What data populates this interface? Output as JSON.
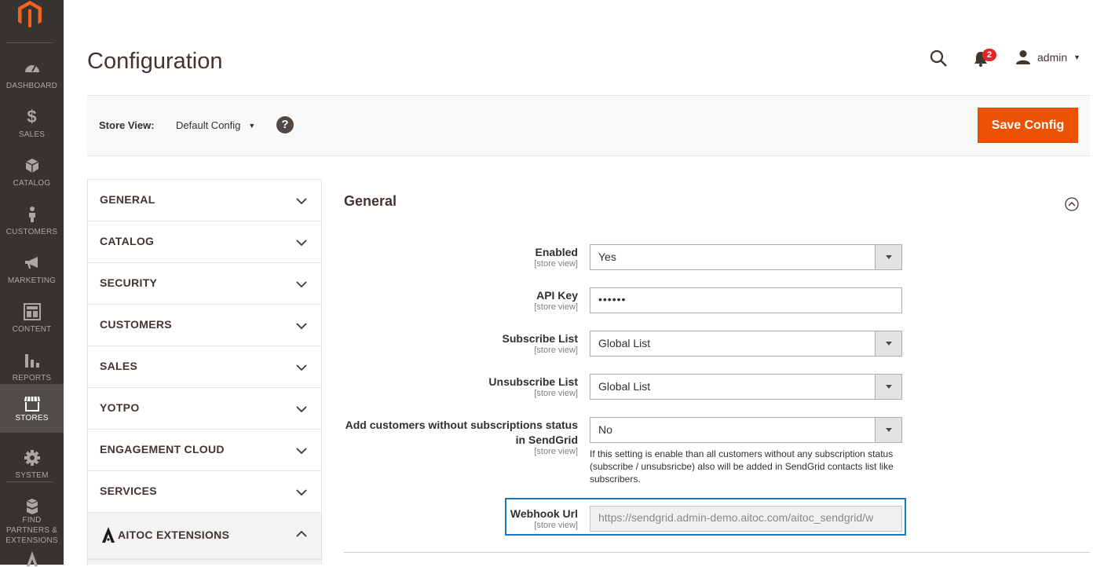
{
  "nav": {
    "items": [
      {
        "label": "DASHBOARD",
        "icon": "dashboard-icon"
      },
      {
        "label": "SALES",
        "icon": "dollar-icon"
      },
      {
        "label": "CATALOG",
        "icon": "cube-icon"
      },
      {
        "label": "CUSTOMERS",
        "icon": "person-icon"
      },
      {
        "label": "MARKETING",
        "icon": "megaphone-icon"
      },
      {
        "label": "CONTENT",
        "icon": "layout-icon"
      },
      {
        "label": "REPORTS",
        "icon": "bar-chart-icon"
      },
      {
        "label": "STORES",
        "icon": "storefront-icon",
        "active": true
      },
      {
        "label": "SYSTEM",
        "icon": "gear-icon"
      },
      {
        "label": "FIND PARTNERS & EXTENSIONS",
        "icon": "boxes-icon"
      }
    ]
  },
  "header": {
    "title": "Configuration",
    "notification_count": "2",
    "user": "admin"
  },
  "scope": {
    "label": "Store View:",
    "value": "Default Config",
    "help": "?",
    "save_label": "Save Config"
  },
  "tabs": [
    {
      "label": "GENERAL"
    },
    {
      "label": "CATALOG"
    },
    {
      "label": "SECURITY"
    },
    {
      "label": "CUSTOMERS"
    },
    {
      "label": "SALES"
    },
    {
      "label": "YOTPO"
    },
    {
      "label": "ENGAGEMENT CLOUD"
    },
    {
      "label": "SERVICES"
    },
    {
      "label": "AITOC EXTENSIONS",
      "open": true
    }
  ],
  "section": {
    "title": "General",
    "fields": {
      "enabled": {
        "label": "Enabled",
        "scope": "[store view]",
        "value": "Yes"
      },
      "api_key": {
        "label": "API Key",
        "scope": "[store view]",
        "value": "••••••"
      },
      "subscribe_list": {
        "label": "Subscribe List",
        "scope": "[store view]",
        "value": "Global List"
      },
      "unsubscribe_list": {
        "label": "Unsubscribe List",
        "scope": "[store view]",
        "value": "Global List"
      },
      "add_customers": {
        "label_line1": "Add customers without subscriptions status",
        "label_line2": "in SendGrid",
        "scope": "[store view]",
        "value": "No",
        "note": "If this setting is enable than all customers without any subscription status (subscribe / unsubsricbe) also will be added in SendGrid contacts list like subscribers."
      },
      "webhook": {
        "label": "Webhook Url",
        "scope": "[store view]",
        "value": "https://sendgrid.admin-demo.aitoc.com/aitoc_sendgrid/w"
      }
    }
  },
  "colors": {
    "accent": "#eb5202",
    "menu_bg": "#373330",
    "focus": "#1979c3"
  }
}
